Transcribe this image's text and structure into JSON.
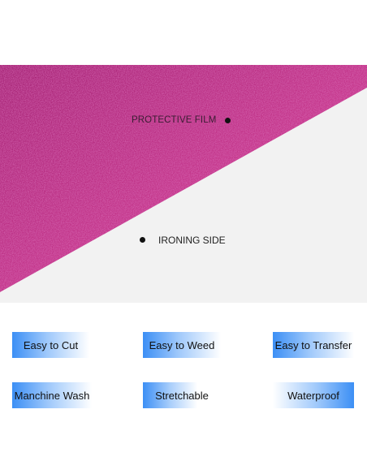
{
  "photo": {
    "protective_film_label": "PROTECTIVE FILM",
    "ironing_side_label": "IRONING SIDE",
    "glitter_color": "#b8287e"
  },
  "features": [
    {
      "label": "Easy to Cut"
    },
    {
      "label": "Easy to Weed"
    },
    {
      "label": "Easy to Transfer"
    },
    {
      "label": "Manchine Wash"
    },
    {
      "label": "Stretchable"
    },
    {
      "label": "Waterproof"
    }
  ]
}
